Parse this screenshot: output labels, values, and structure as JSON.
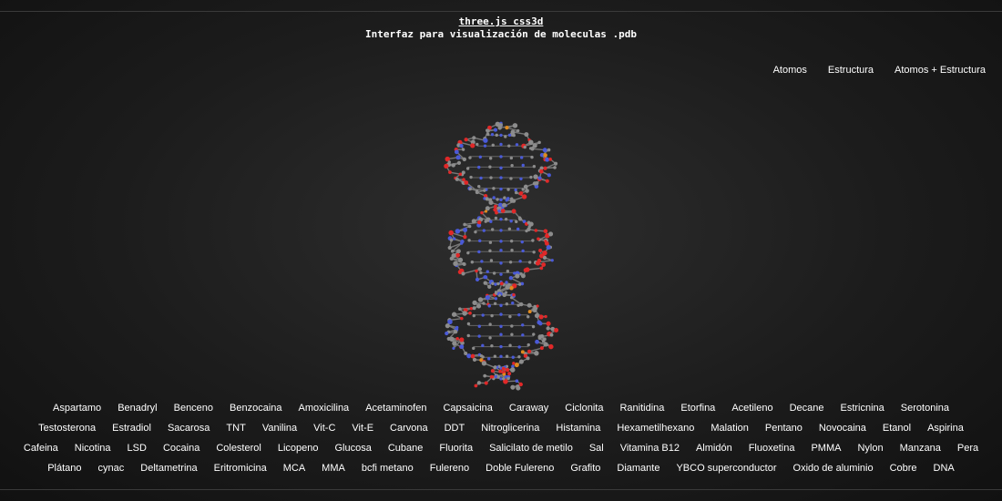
{
  "header": {
    "link": "three.js css3d",
    "subtitle": "Interfaz para visualización de moleculas .pdb"
  },
  "menu": [
    "Atomos",
    "Estructura",
    "Atomos + Estructura"
  ],
  "viewer": {
    "molecule_shown": "DNA",
    "atom_colors": {
      "carbon": "#8c8c8c",
      "oxygen": "#e02828",
      "nitrogen": "#4a5ad8",
      "phosphorus": "#e08a1e"
    }
  },
  "molecules": [
    "Aspartamo",
    "Benadryl",
    "Benceno",
    "Benzocaina",
    "Amoxicilina",
    "Acetaminofen",
    "Capsaicina",
    "Caraway",
    "Ciclonita",
    "Ranitidina",
    "Etorfina",
    "Acetileno",
    "Decane",
    "Estricnina",
    "Serotonina",
    "Testosterona",
    "Estradiol",
    "Sacarosa",
    "TNT",
    "Vanilina",
    "Vit-C",
    "Vit-E",
    "Carvona",
    "DDT",
    "Nitroglicerina",
    "Histamina",
    "Hexametilhexano",
    "Malation",
    "Pentano",
    "Novocaina",
    "Etanol",
    "Aspirina",
    "Cafeina",
    "Nicotina",
    "LSD",
    "Cocaina",
    "Colesterol",
    "Licopeno",
    "Glucosa",
    "Cubane",
    "Fluorita",
    "Salicilato de metilo",
    "Sal",
    "Vitamina B12",
    "Almidón",
    "Fluoxetina",
    "PMMA",
    "Nylon",
    "Manzana",
    "Pera",
    "Plátano",
    "cynac",
    "Deltametrina",
    "Eritromicina",
    "MCA",
    "MMA",
    "bcfi metano",
    "Fulereno",
    "Doble Fulereno",
    "Grafito",
    "Diamante",
    "YBCO superconductor",
    "Oxido de aluminio",
    "Cobre",
    "DNA"
  ]
}
